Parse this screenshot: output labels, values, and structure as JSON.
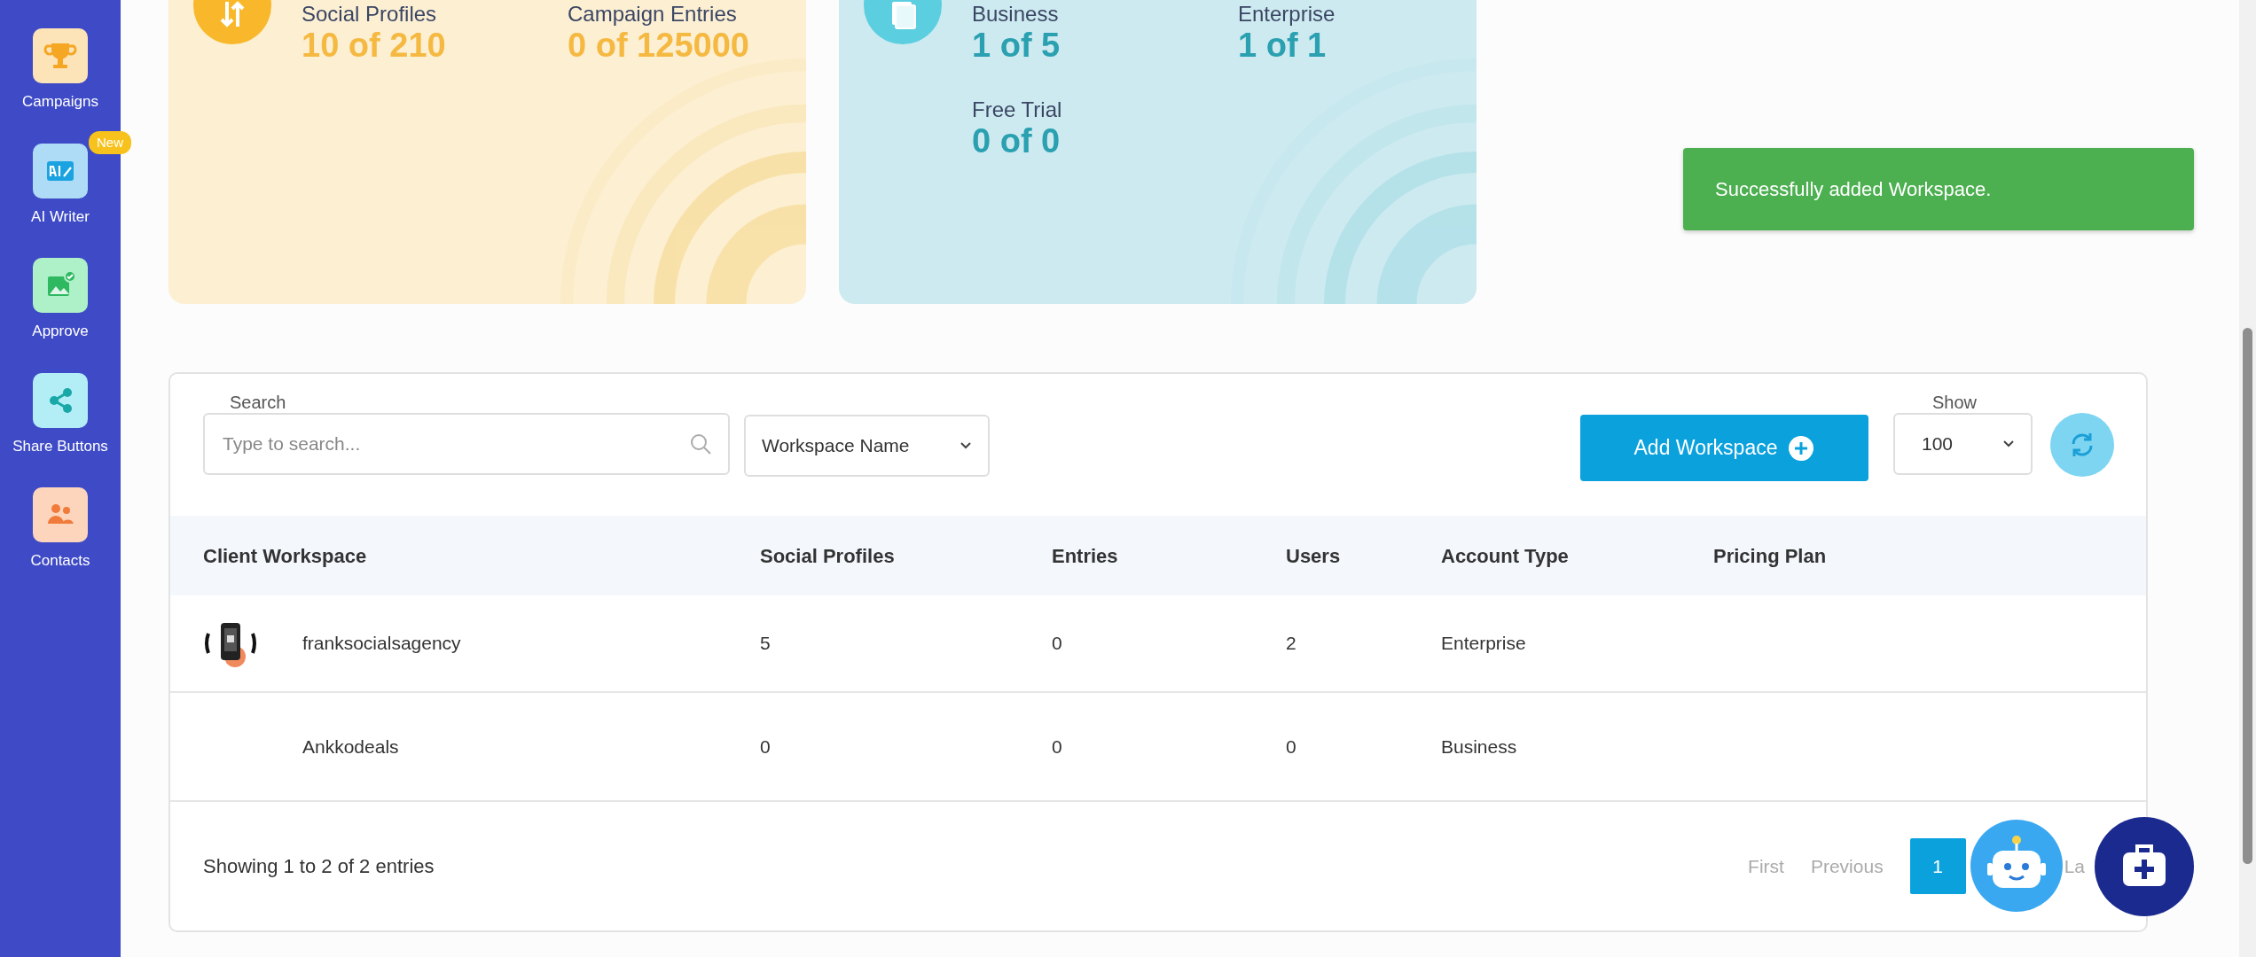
{
  "sidebar": {
    "items": [
      {
        "label": "Campaigns"
      },
      {
        "label": "AI Writer",
        "badge": "New"
      },
      {
        "label": "Approve"
      },
      {
        "label": "Share Buttons"
      },
      {
        "label": "Contacts"
      }
    ]
  },
  "summary_cards": [
    {
      "stats": [
        {
          "label": "Social Profiles",
          "value": "10 of 210"
        },
        {
          "label": "Campaign Entries",
          "value": "0 of 125000"
        }
      ]
    },
    {
      "stats": [
        {
          "label": "Business",
          "value": "1 of 5"
        },
        {
          "label": "Enterprise",
          "value": "1 of 1"
        },
        {
          "label": "Free Trial",
          "value": "0 of 0"
        }
      ]
    }
  ],
  "toast": {
    "message": "Successfully added Workspace."
  },
  "table": {
    "search": {
      "label": "Search",
      "placeholder": "Type to search..."
    },
    "filter": {
      "value": "Workspace Name"
    },
    "add_button": "Add Workspace",
    "show": {
      "label": "Show",
      "value": "100"
    },
    "columns": [
      "Client Workspace",
      "Social Profiles",
      "Entries",
      "Users",
      "Account Type",
      "Pricing Plan"
    ],
    "rows": [
      {
        "has_logo": true,
        "cells": [
          "franksocialsagency",
          "5",
          "0",
          "2",
          "Enterprise"
        ]
      },
      {
        "has_logo": false,
        "cells": [
          "Ankkodeals",
          "0",
          "0",
          "0",
          "Business"
        ]
      }
    ],
    "info": "Showing 1 to 2 of 2 entries",
    "pagination": [
      {
        "label": "First",
        "selected": false
      },
      {
        "label": "Previous",
        "selected": false
      },
      {
        "label": "1",
        "selected": true
      },
      {
        "label": "La",
        "selected": false
      }
    ]
  }
}
